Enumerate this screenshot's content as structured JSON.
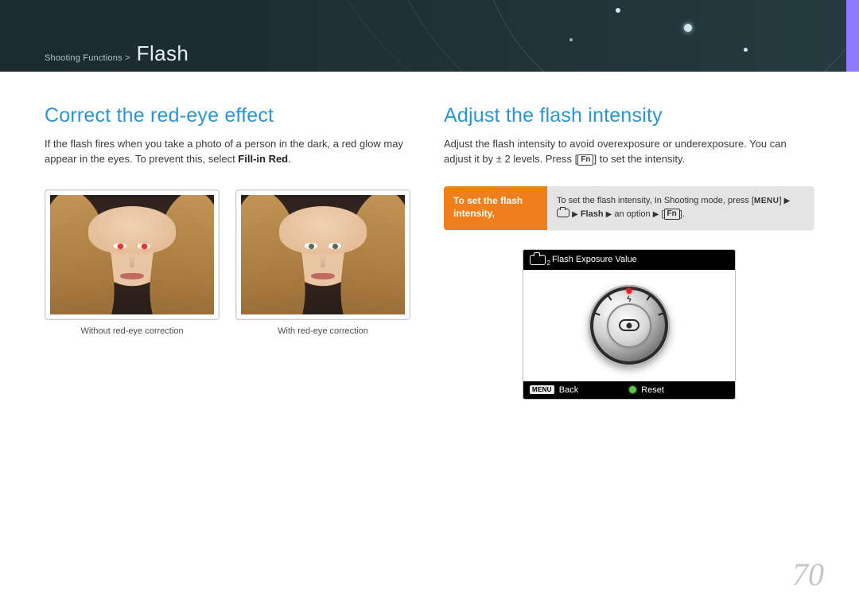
{
  "breadcrumb": {
    "parent": "Shooting Functions >",
    "current": "Flash"
  },
  "page_number": "70",
  "left": {
    "heading": "Correct the red-eye effect",
    "paragraph_a": "If the flash fires when you take a photo of a person in the dark, a red glow may appear in the eyes. To prevent this, select ",
    "paragraph_bold": "Fill-in Red",
    "paragraph_b": ".",
    "caption_left": "Without red-eye correction",
    "caption_right": "With red-eye correction"
  },
  "right": {
    "heading": "Adjust the flash intensity",
    "paragraph": "Adjust the flash intensity to avoid overexposure or underexposure. You can adjust it by ± 2 levels. Press [Fn] to set the intensity.",
    "instr_label": "To set the flash intensity,",
    "instr_line1_a": "To set the flash intensity, In Shooting mode, press [",
    "instr_menu": "MENU",
    "instr_line1_b": "]",
    "instr_flash": "Flash",
    "instr_option": "an option",
    "instr_fn": "Fn",
    "screen_title": "Flash Exposure Value",
    "screen_back": "Back",
    "screen_reset": "Reset",
    "screen_menu_chip": "MENU"
  }
}
